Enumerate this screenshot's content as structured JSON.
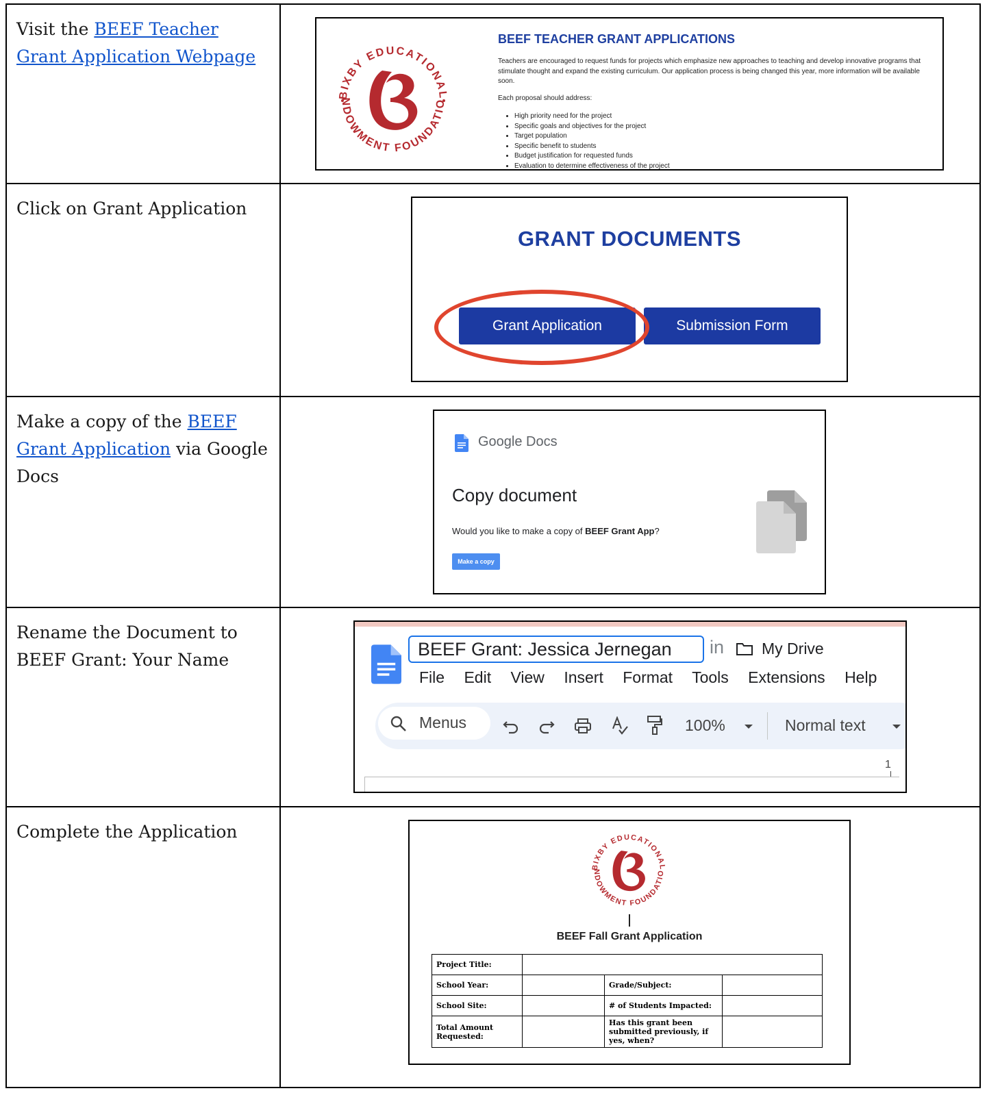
{
  "rows": [
    {
      "step_prefix": "Visit the ",
      "step_link": "BEEF Teacher Grant Application Webpage",
      "step_suffix": ""
    },
    {
      "step_text": "Click on Grant Application"
    },
    {
      "step_prefix": "Make a copy of the ",
      "step_link": "BEEF Grant Application",
      "step_suffix": " via Google Docs"
    },
    {
      "step_text": "Rename the Document to BEEF Grant: Your Name"
    },
    {
      "step_text": "Complete the Application"
    }
  ],
  "logo": {
    "top_text": "BIXBY EDUCATIONAL",
    "bottom_text": "ENDOWMENT FOUNDATION",
    "letter": "B",
    "color": "#b52a2f"
  },
  "webpage": {
    "title": "BEEF TEACHER GRANT APPLICATIONS",
    "intro": "Teachers are encouraged to request funds for projects which emphasize new approaches to teaching and develop innovative programs that stimulate thought and expand the existing curriculum. Our application process is being changed this year, more information will be available soon.",
    "list_intro": "Each proposal should address:",
    "bullets": [
      "High priority need for the project",
      "Specific goals and objectives for the project",
      "Target population",
      "Specific benefit to students",
      "Budget justification for requested funds",
      "Evaluation to determine effectiveness of the project"
    ]
  },
  "grant_docs": {
    "title": "GRANT DOCUMENTS",
    "button1": "Grant Application",
    "button2": "Submission Form",
    "accent": "#1c3aa2",
    "highlight": "#e0452e"
  },
  "copy_dialog": {
    "brand": "Google Docs",
    "heading": "Copy document",
    "question_prefix": "Would you like to make a copy of ",
    "question_doc": "BEEF Grant App",
    "question_suffix": "?",
    "button": "Make a copy"
  },
  "docs_editor": {
    "doc_title": "BEEF Grant: Jessica Jernegan",
    "in_label": "in",
    "location": "My Drive",
    "menus": [
      "File",
      "Edit",
      "View",
      "Insert",
      "Format",
      "Tools",
      "Extensions",
      "Help"
    ],
    "search_label": "Menus",
    "zoom": "100%",
    "style": "Normal text",
    "ruler_mark": "1"
  },
  "application": {
    "title": "BEEF Fall Grant Application",
    "fields": {
      "project_title": "Project Title:",
      "school_year": "School Year:",
      "grade_subject": "Grade/Subject:",
      "school_site": "School Site:",
      "students_impacted": "# of Students Impacted:",
      "total_amount": "Total Amount Requested:",
      "submitted_previously": "Has this grant been submitted previously, if yes, when?"
    }
  }
}
